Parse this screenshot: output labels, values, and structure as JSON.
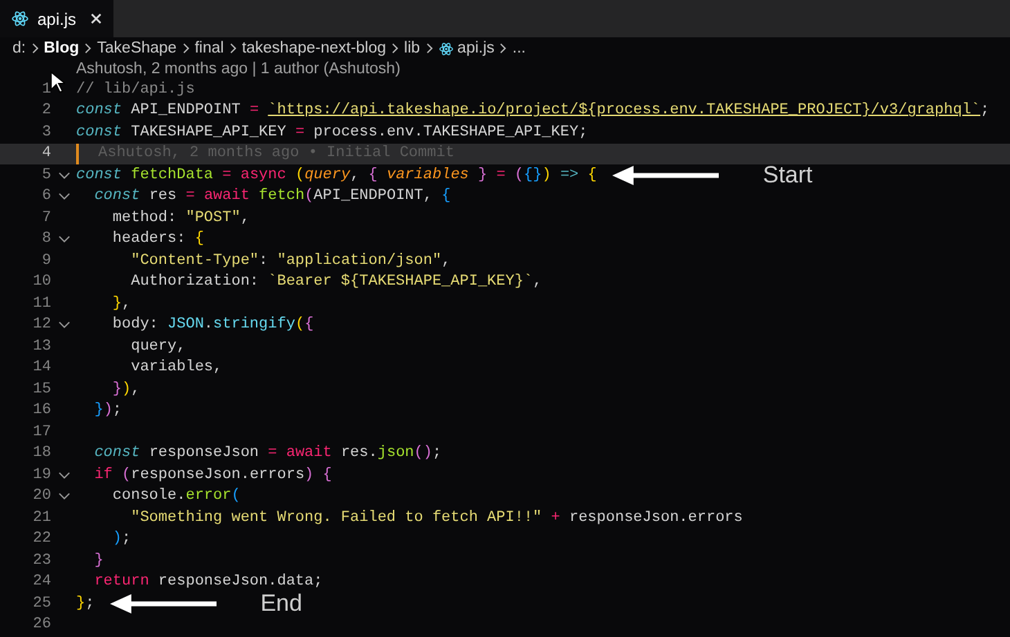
{
  "tab": {
    "label": "api.js",
    "selected": true
  },
  "breadcrumbs": [
    "d:",
    "Blog",
    "TakeShape",
    "final",
    "takeshape-next-blog",
    "lib",
    "api.js",
    "..."
  ],
  "codelens": "Ashutosh, 2 months ago | 1 author (Ashutosh)",
  "lines": [
    {
      "number": "1",
      "fold": false,
      "current": false,
      "tokens": [
        {
          "text": "// lib/api.js",
          "kind": "comment"
        }
      ]
    },
    {
      "number": "2",
      "fold": false,
      "current": false,
      "tokens": [
        {
          "text": "const",
          "kind": "storage"
        },
        {
          "text": " API_ENDPOINT ",
          "kind": "plain"
        },
        {
          "text": "= ",
          "kind": "op"
        },
        {
          "text": "`https://api.takeshape.io/project/${process.env.TAKESHAPE_PROJECT}/v3/graphql`",
          "kind": "link"
        },
        {
          "text": ";",
          "kind": "plain"
        }
      ]
    },
    {
      "number": "3",
      "fold": false,
      "current": false,
      "tokens": [
        {
          "text": "const",
          "kind": "storage"
        },
        {
          "text": " TAKESHAPE_API_KEY ",
          "kind": "plain"
        },
        {
          "text": "=",
          "kind": "op"
        },
        {
          "text": " process.env.TAKESHAPE_API_KEY;",
          "kind": "plain"
        }
      ]
    },
    {
      "number": "4",
      "fold": false,
      "current": true,
      "blame": "Ashutosh, 2 months ago • Initial Commit"
    },
    {
      "number": "5",
      "fold": true,
      "current": false,
      "tokens": [
        {
          "text": "const",
          "kind": "storage"
        },
        {
          "text": " fetchData ",
          "kind": "func"
        },
        {
          "text": "= ",
          "kind": "op"
        },
        {
          "text": "async ",
          "kind": "keyword"
        },
        {
          "text": "(",
          "kind": "b1"
        },
        {
          "text": "query",
          "kind": "param"
        },
        {
          "text": ", ",
          "kind": "plain"
        },
        {
          "text": "{ ",
          "kind": "b2"
        },
        {
          "text": "variables",
          "kind": "param"
        },
        {
          "text": " } ",
          "kind": "b2"
        },
        {
          "text": "= ",
          "kind": "op"
        },
        {
          "text": "(",
          "kind": "b2"
        },
        {
          "text": "{}",
          "kind": "b3"
        },
        {
          "text": ") ",
          "kind": "b1"
        },
        {
          "text": "=> ",
          "kind": "storage"
        },
        {
          "text": "{",
          "kind": "b1"
        }
      ],
      "annotation": "Start"
    },
    {
      "number": "6",
      "fold": true,
      "current": false,
      "tokens": [
        {
          "text": "  const",
          "kind": "storage"
        },
        {
          "text": " res ",
          "kind": "plain"
        },
        {
          "text": "= ",
          "kind": "op"
        },
        {
          "text": "await ",
          "kind": "keyword"
        },
        {
          "text": "fetch",
          "kind": "func"
        },
        {
          "text": "(",
          "kind": "b2"
        },
        {
          "text": "API_ENDPOINT, ",
          "kind": "plain"
        },
        {
          "text": "{",
          "kind": "b3"
        }
      ]
    },
    {
      "number": "7",
      "fold": false,
      "current": false,
      "tokens": [
        {
          "text": "    method: ",
          "kind": "plain"
        },
        {
          "text": "\"POST\"",
          "kind": "string"
        },
        {
          "text": ",",
          "kind": "plain"
        }
      ]
    },
    {
      "number": "8",
      "fold": true,
      "current": false,
      "tokens": [
        {
          "text": "    headers: ",
          "kind": "plain"
        },
        {
          "text": "{",
          "kind": "b1"
        }
      ]
    },
    {
      "number": "9",
      "fold": false,
      "current": false,
      "tokens": [
        {
          "text": "      \"Content-Type\"",
          "kind": "string"
        },
        {
          "text": ": ",
          "kind": "plain"
        },
        {
          "text": "\"application/json\"",
          "kind": "string"
        },
        {
          "text": ",",
          "kind": "plain"
        }
      ]
    },
    {
      "number": "10",
      "fold": false,
      "current": false,
      "tokens": [
        {
          "text": "      Authorization: ",
          "kind": "plain"
        },
        {
          "text": "`Bearer ${TAKESHAPE_API_KEY}`",
          "kind": "string"
        },
        {
          "text": ",",
          "kind": "plain"
        }
      ]
    },
    {
      "number": "11",
      "fold": false,
      "current": false,
      "tokens": [
        {
          "text": "    }",
          "kind": "b1"
        },
        {
          "text": ",",
          "kind": "plain"
        }
      ]
    },
    {
      "number": "12",
      "fold": true,
      "current": false,
      "tokens": [
        {
          "text": "    body: ",
          "kind": "plain"
        },
        {
          "text": "JSON",
          "kind": "support"
        },
        {
          "text": ".",
          "kind": "plain"
        },
        {
          "text": "stringify",
          "kind": "support"
        },
        {
          "text": "(",
          "kind": "b1"
        },
        {
          "text": "{",
          "kind": "b2"
        }
      ]
    },
    {
      "number": "13",
      "fold": false,
      "current": false,
      "tokens": [
        {
          "text": "      query,",
          "kind": "plain"
        }
      ]
    },
    {
      "number": "14",
      "fold": false,
      "current": false,
      "tokens": [
        {
          "text": "      variables,",
          "kind": "plain"
        }
      ]
    },
    {
      "number": "15",
      "fold": false,
      "current": false,
      "tokens": [
        {
          "text": "    }",
          "kind": "b2"
        },
        {
          "text": ")",
          "kind": "b1"
        },
        {
          "text": ",",
          "kind": "plain"
        }
      ]
    },
    {
      "number": "16",
      "fold": false,
      "current": false,
      "tokens": [
        {
          "text": "  }",
          "kind": "b3"
        },
        {
          "text": ")",
          "kind": "b2"
        },
        {
          "text": ";",
          "kind": "plain"
        }
      ]
    },
    {
      "number": "17",
      "fold": false,
      "current": false
    },
    {
      "number": "18",
      "fold": false,
      "current": false,
      "tokens": [
        {
          "text": "  const",
          "kind": "storage"
        },
        {
          "text": " responseJson ",
          "kind": "plain"
        },
        {
          "text": "= ",
          "kind": "op"
        },
        {
          "text": "await",
          "kind": "keyword"
        },
        {
          "text": " res.",
          "kind": "plain"
        },
        {
          "text": "json",
          "kind": "func"
        },
        {
          "text": "()",
          "kind": "b2"
        },
        {
          "text": ";",
          "kind": "plain"
        }
      ]
    },
    {
      "number": "19",
      "fold": true,
      "current": false,
      "tokens": [
        {
          "text": "  if ",
          "kind": "keyword"
        },
        {
          "text": "(",
          "kind": "b2"
        },
        {
          "text": "responseJson.errors",
          "kind": "plain"
        },
        {
          "text": ") {",
          "kind": "b2"
        }
      ]
    },
    {
      "number": "20",
      "fold": true,
      "current": false,
      "tokens": [
        {
          "text": "    console.",
          "kind": "plain"
        },
        {
          "text": "error",
          "kind": "func"
        },
        {
          "text": "(",
          "kind": "b3"
        }
      ]
    },
    {
      "number": "21",
      "fold": false,
      "current": false,
      "tokens": [
        {
          "text": "      \"Something went Wrong. Failed to fetch API!!\"",
          "kind": "string"
        },
        {
          "text": " + ",
          "kind": "op"
        },
        {
          "text": "responseJson.errors",
          "kind": "plain"
        }
      ]
    },
    {
      "number": "22",
      "fold": false,
      "current": false,
      "tokens": [
        {
          "text": "    )",
          "kind": "b3"
        },
        {
          "text": ";",
          "kind": "plain"
        }
      ]
    },
    {
      "number": "23",
      "fold": false,
      "current": false,
      "tokens": [
        {
          "text": "  }",
          "kind": "b2"
        }
      ]
    },
    {
      "number": "24",
      "fold": false,
      "current": false,
      "tokens": [
        {
          "text": "  return",
          "kind": "keyword"
        },
        {
          "text": " responseJson.data;",
          "kind": "plain"
        }
      ]
    },
    {
      "number": "25",
      "fold": false,
      "current": false,
      "tokens": [
        {
          "text": "}",
          "kind": "b1"
        },
        {
          "text": ";",
          "kind": "plain"
        }
      ],
      "annotation": "End"
    },
    {
      "number": "26",
      "fold": false,
      "current": false
    }
  ]
}
